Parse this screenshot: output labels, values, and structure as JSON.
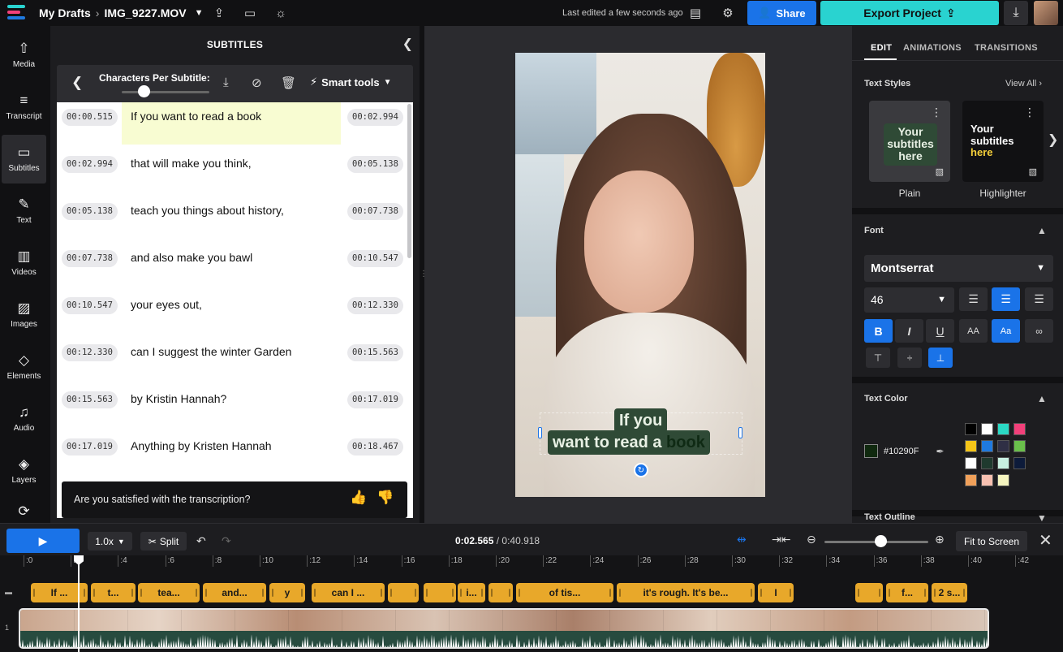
{
  "topbar": {
    "drafts": "My Drafts",
    "filename": "IMG_9227.MOV",
    "last_edited": "Last edited a few seconds ago",
    "share": "Share",
    "export": "Export Project"
  },
  "rail": [
    {
      "label": "Media",
      "icon": "media-icon"
    },
    {
      "label": "Transcript",
      "icon": "transcript-icon"
    },
    {
      "label": "Subtitles",
      "icon": "subtitles-icon"
    },
    {
      "label": "Text",
      "icon": "text-icon"
    },
    {
      "label": "Videos",
      "icon": "videos-icon"
    },
    {
      "label": "Images",
      "icon": "images-icon"
    },
    {
      "label": "Elements",
      "icon": "elements-icon"
    },
    {
      "label": "Audio",
      "icon": "audio-icon"
    },
    {
      "label": "Layers",
      "icon": "layers-icon"
    }
  ],
  "subtitles": {
    "title": "SUBTITLES",
    "cps_label": "Characters Per Subtitle:",
    "smart_tools": "Smart tools",
    "rows": [
      {
        "start": "00:00.515",
        "text": "If you want to read a book",
        "end": "00:02.994"
      },
      {
        "start": "00:02.994",
        "text": "that will make you think,",
        "end": "00:05.138"
      },
      {
        "start": "00:05.138",
        "text": "teach you things about history,",
        "end": "00:07.738"
      },
      {
        "start": "00:07.738",
        "text": "and also make you bawl",
        "end": "00:10.547"
      },
      {
        "start": "00:10.547",
        "text": "your eyes out,",
        "end": "00:12.330"
      },
      {
        "start": "00:12.330",
        "text": "can I suggest the winter Garden",
        "end": "00:15.563"
      },
      {
        "start": "00:15.563",
        "text": "by Kristin Hannah?",
        "end": "00:17.019"
      },
      {
        "start": "00:17.019",
        "text": "Anything by Kristen Hannah",
        "end": "00:18.467"
      }
    ],
    "feedback": "Are you satisfied with the transcription?"
  },
  "canvas": {
    "caption_line1": "If you",
    "caption_line2": "want to read a",
    "caption_highlight": "book"
  },
  "right": {
    "tabs": [
      "EDIT",
      "ANIMATIONS",
      "TRANSITIONS"
    ],
    "text_styles": "Text Styles",
    "view_all": "View All",
    "style_plain_preview": "Your subtitles here",
    "style_highlight_preview_1": "Your",
    "style_highlight_preview_2": "subtitles",
    "style_highlight_preview_3": "here",
    "style_plain": "Plain",
    "style_highlighter": "Highlighter",
    "font_section": "Font",
    "font_name": "Montserrat",
    "font_size": "46",
    "text_color_section": "Text Color",
    "text_color_hex": "#10290F",
    "text_outline_section": "Text Outline",
    "palette": [
      "#000000",
      "#ffffff",
      "#2bd9c4",
      "#f2407a",
      "#f5c518",
      "#1f7ae0",
      "#2f2f45",
      "#6abf4b",
      "#ffffff",
      "#1f3a2e",
      "#c9f1e2",
      "#0d1b3a",
      "#f0a05a",
      "#f7c0b0",
      "#f5f5c0"
    ]
  },
  "timeline": {
    "speed": "1.0x",
    "split": "Split",
    "time_current": "0:02.565",
    "time_total": "0:40.918",
    "fit": "Fit to Screen",
    "ticks": [
      ":0",
      ":2",
      ":4",
      ":6",
      ":8",
      ":10",
      ":12",
      ":14",
      ":16",
      ":18",
      ":20",
      ":22",
      ":24",
      ":26",
      ":28",
      ":30",
      ":32",
      ":34",
      ":36",
      ":38",
      ":40",
      ":42"
    ],
    "track_subtitle": "",
    "track_video": "1",
    "segments": [
      "If ...",
      "t...",
      "tea...",
      "and...",
      "y",
      "can I ...",
      "",
      "",
      "i...",
      "",
      "of tis...",
      "it's rough. It's be...",
      "I",
      "",
      "f...",
      "2 s..."
    ]
  }
}
